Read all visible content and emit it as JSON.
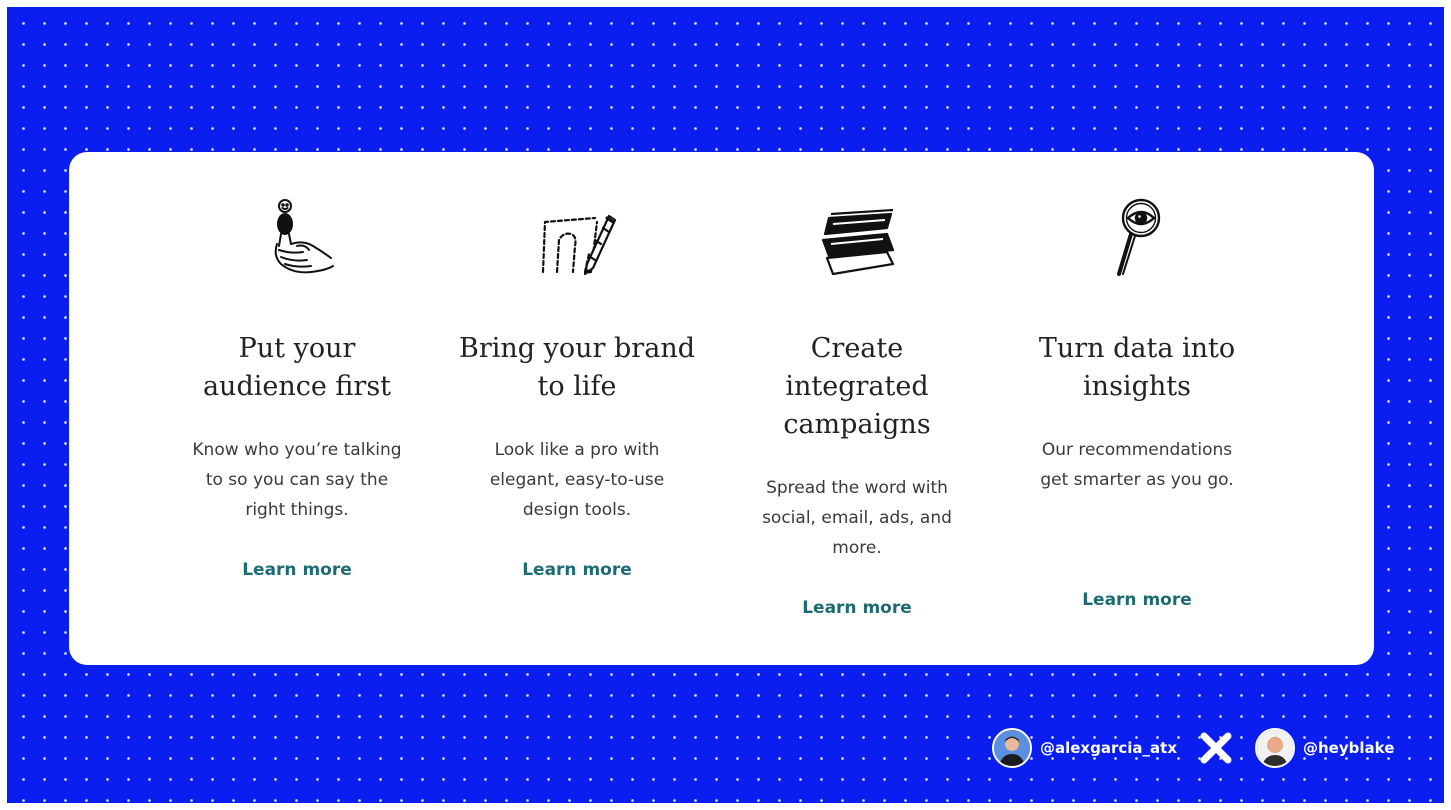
{
  "features": [
    {
      "icon": "hand-with-figure-icon",
      "heading": "Put your audience first",
      "description": "Know who you’re talking to so you can say the right things.",
      "link": "Learn more"
    },
    {
      "icon": "pencil-drawing-icon",
      "heading": "Bring your brand to life",
      "description": "Look like a pro with elegant, easy-to-use design tools.",
      "link": "Learn more"
    },
    {
      "icon": "stacked-layers-icon",
      "heading": "Create integrated campaigns",
      "description": "Spread the word with social, email, ads, and more.",
      "link": "Learn more"
    },
    {
      "icon": "magnifier-eye-icon",
      "heading": "Turn data into insights",
      "description": "Our recommendations get smarter as you go.",
      "link": "Learn more"
    }
  ],
  "credits": {
    "handle_1": "@alexgarcia_atx",
    "separator_icon": "x-icon",
    "handle_2": "@heyblake"
  },
  "colors": {
    "background": "#0a1ef0",
    "card": "#ffffff",
    "link": "#1e6b73",
    "heading": "#222222"
  }
}
